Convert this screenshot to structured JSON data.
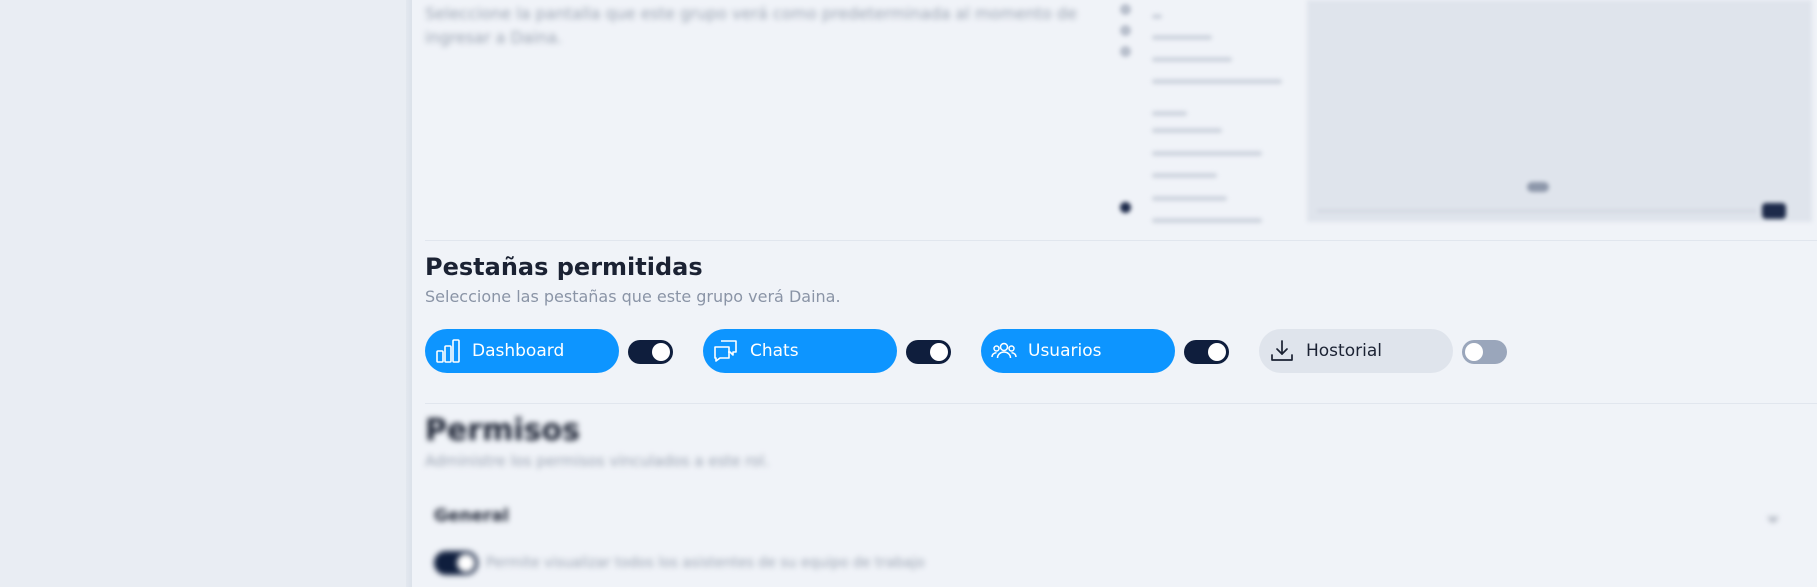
{
  "default_screen": {
    "description": "Seleccione la pantalla que este grupo verá como predeterminada al momento de ingresar a Daina."
  },
  "tabs_section": {
    "title": "Pestañas permitidas",
    "subtitle": "Seleccione las pestañas que este grupo verá Daina.",
    "tabs": [
      {
        "label": "Dashboard",
        "icon": "bar-chart-icon",
        "enabled": true
      },
      {
        "label": "Chats",
        "icon": "chat-bubbles-icon",
        "enabled": true
      },
      {
        "label": "Usuarios",
        "icon": "users-icon",
        "enabled": true
      },
      {
        "label": "Hostorial",
        "icon": "download-icon",
        "enabled": false
      }
    ]
  },
  "permissions": {
    "title": "Permisos",
    "subtitle": "Administre los permisos vinculados a este rol.",
    "group_label": "General",
    "items": [
      {
        "label": "Permite visualizar todos los asistentes de su equipo de trabajo",
        "enabled": true
      }
    ]
  },
  "colors": {
    "accent": "#0d95ff",
    "toggle_on": "#0f1e3d",
    "toggle_off": "#9aa6bb",
    "chip_off": "#dfe4ec"
  }
}
